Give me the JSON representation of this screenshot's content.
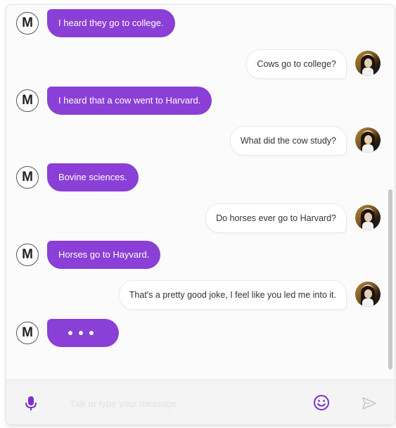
{
  "chat": {
    "bot_avatar_letter": "M",
    "messages": [
      {
        "from": "bot",
        "text": "I heard they go to college."
      },
      {
        "from": "user",
        "text": "Cows go to college?"
      },
      {
        "from": "bot",
        "text": "I heard that a cow went to Harvard."
      },
      {
        "from": "user",
        "text": "What did the cow study?"
      },
      {
        "from": "bot",
        "text": "Bovine sciences."
      },
      {
        "from": "user",
        "text": "Do horses ever go to Harvard?"
      },
      {
        "from": "bot",
        "text": "Horses go to Hayvard."
      },
      {
        "from": "user",
        "text": "That's a pretty good joke, I feel like you led me into it."
      }
    ],
    "typing_indicator": "•••"
  },
  "input": {
    "placeholder": "Talk or type your message",
    "value": ""
  },
  "icons": {
    "mic": "microphone-icon",
    "emoji": "smiley-icon",
    "send": "send-icon"
  },
  "colors": {
    "bot_bubble": "#8a3fd6",
    "accent": "#7b2fd1",
    "send_disabled": "#c9c9c9"
  }
}
